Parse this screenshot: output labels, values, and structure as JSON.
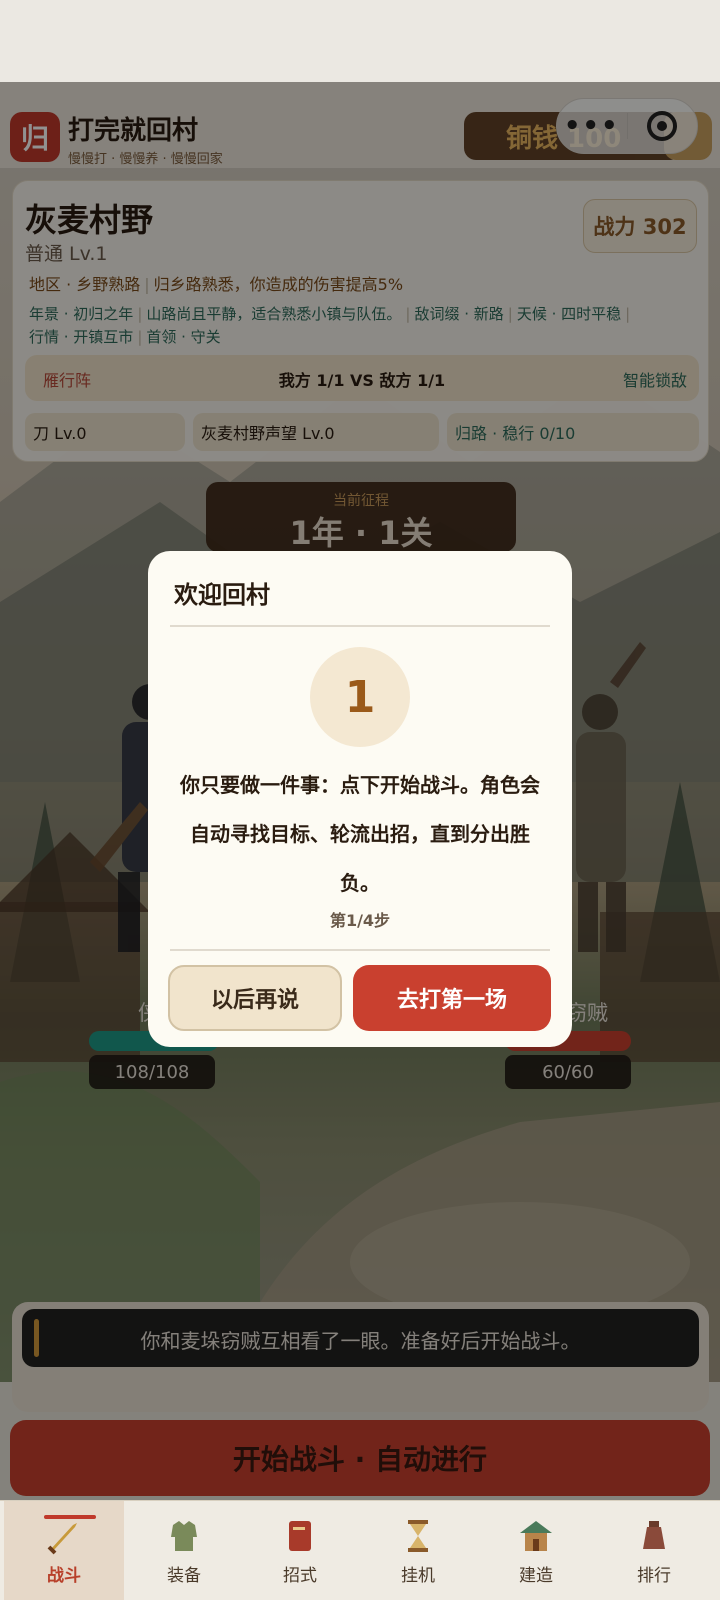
{
  "app": {
    "logo_char": "归",
    "title": "打完就回村",
    "subtitle": "慢慢打 · 慢慢养 · 慢慢回家",
    "coins": "铜钱 100"
  },
  "stage": {
    "name": "灰麦村野",
    "level": "普通 Lv.1",
    "power": "战力 302",
    "region_label": "地区 · 乡野熟路",
    "region_effect": "归乡路熟悉，你造成的伤害提高5%",
    "scene_year": "年景 · 初归之年",
    "scene_desc": "山路尚且平静，适合熟悉小镇与队伍。",
    "enemy_word": "敌词缀 · 新路",
    "weather": "天候 · 四时平稳",
    "market": "行情 · 开镇互市",
    "leader": "首领 · 守关",
    "formation": "雁行阵",
    "versus": "我方 1/1  VS  敌方 1/1",
    "smart_lock": "智能锁敌",
    "weapon": "刀 Lv.0",
    "reputation": "灰麦村野声望 Lv.0",
    "return_path": "归路 · 稳行 0/10"
  },
  "journey": {
    "label": "当前征程",
    "value": "1年 · 1关"
  },
  "battle": {
    "left_name": "侠",
    "left_hp_text": "108/108",
    "left_hp_ratio": 1.0,
    "left_hp_color": "#1f9a86",
    "right_name": "窃贼",
    "right_hp_text": "60/60",
    "right_hp_ratio": 1.0,
    "right_hp_color": "#c9402f"
  },
  "log": {
    "message": "你和麦垛窃贼互相看了一眼。准备好后开始战斗。"
  },
  "start_button": "开始战斗 · 自动进行",
  "tabs": [
    {
      "label": "战斗",
      "icon": "sword-icon",
      "active": true
    },
    {
      "label": "装备",
      "icon": "armor-icon",
      "active": false
    },
    {
      "label": "招式",
      "icon": "book-icon",
      "active": false
    },
    {
      "label": "挂机",
      "icon": "hourglass-icon",
      "active": false
    },
    {
      "label": "建造",
      "icon": "house-icon",
      "active": false
    },
    {
      "label": "排行",
      "icon": "pouch-icon",
      "active": false
    }
  ],
  "modal": {
    "title": "欢迎回村",
    "step_number": "1",
    "body": "你只要做一件事：点下开始战斗。角色会自动寻找目标、轮流出招，直到分出胜负。",
    "step_count": "第1/4步",
    "later_button": "以后再说",
    "go_button": "去打第一场"
  },
  "colors": {
    "accent_red": "#c9402f",
    "teal": "#2e6a5a",
    "brown": "#5a3a1e"
  }
}
